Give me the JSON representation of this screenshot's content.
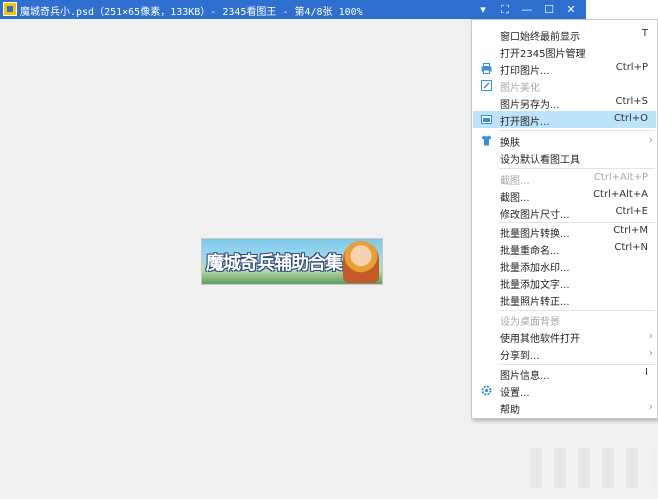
{
  "window": {
    "title": "魔城奇兵小.psd（251×65像素，133KB）- 2345看图王 - 第4/8张 100%",
    "controls": {
      "dropdown": "▾",
      "fullscreen": "⛶",
      "minimize": "—",
      "maximize": "☐",
      "close": "✕"
    }
  },
  "canvas": {
    "banner_text": "魔城奇兵辅助合集"
  },
  "menu": {
    "items": [
      {
        "label": "窗口始终最前显示",
        "shortcut": "T"
      },
      {
        "label": "打开2345图片管理",
        "shortcut": ""
      },
      {
        "label": "打印图片...",
        "shortcut": "Ctrl+P",
        "icon": "printer-icon"
      },
      {
        "label": "图片美化",
        "shortcut": "",
        "icon": "edit-icon",
        "disabled": true
      },
      {
        "label": "图片另存为...",
        "shortcut": "Ctrl+S"
      },
      {
        "label": "打开图片...",
        "shortcut": "Ctrl+O",
        "icon": "open-folder-icon",
        "highlight": true
      },
      {
        "label": "换肤",
        "shortcut": "",
        "icon": "tshirt-icon",
        "submenu": true
      },
      {
        "label": "设为默认看图工具",
        "shortcut": ""
      },
      {
        "label": "截图...",
        "shortcut": "Ctrl+Alt+P",
        "disabled": true
      },
      {
        "label": "截图...",
        "shortcut": "Ctrl+Alt+A"
      },
      {
        "label": "修改图片尺寸...",
        "shortcut": "Ctrl+E"
      },
      {
        "label": "批量图片转换...",
        "shortcut": "Ctrl+M"
      },
      {
        "label": "批量重命名...",
        "shortcut": "Ctrl+N"
      },
      {
        "label": "批量添加水印...",
        "shortcut": ""
      },
      {
        "label": "批量添加文字...",
        "shortcut": ""
      },
      {
        "label": "批量照片转正...",
        "shortcut": ""
      },
      {
        "label": "设为桌面背景",
        "shortcut": "",
        "disabled": true
      },
      {
        "label": "使用其他软件打开",
        "shortcut": "",
        "submenu": true
      },
      {
        "label": "分享到...",
        "shortcut": "",
        "submenu": true
      },
      {
        "label": "图片信息...",
        "shortcut": "I"
      },
      {
        "label": "设置...",
        "shortcut": "",
        "icon": "gear-icon"
      },
      {
        "label": "帮助",
        "shortcut": "",
        "submenu": true
      }
    ],
    "submenu_arrow": "›"
  },
  "colors": {
    "titlebar": "#2f6fd0",
    "highlight": "#bde3fb",
    "icon_blue": "#3a8fd8"
  }
}
